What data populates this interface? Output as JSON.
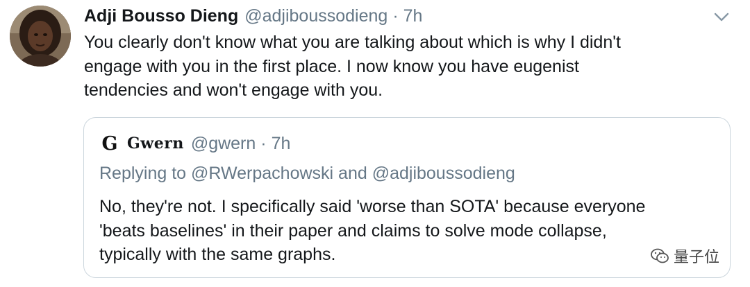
{
  "tweet": {
    "author_name": "Adji Bousso Dieng",
    "author_handle": "@adjiboussodieng",
    "separator": "·",
    "time": "7h",
    "text_lines": [
      "You clearly don't know what you are talking about which is why I didn't",
      "engage with you in the first place. I now know you have eugenist",
      "tendencies and won't engage with you."
    ],
    "menu_icon": "chevron-down-icon"
  },
  "quoted_tweet": {
    "avatar_glyph": "G",
    "author_name": "Gwern",
    "author_handle": "@gwern",
    "separator": "·",
    "time": "7h",
    "replying_to": "Replying to @RWerpachowski and @adjiboussodieng",
    "text_lines": [
      "No, they're not. I specifically said 'worse than SOTA' because everyone",
      "'beats baselines' in their paper and claims to solve mode collapse,",
      "typically with the same graphs."
    ]
  },
  "watermark": {
    "icon": "wechat-icon",
    "text": "量子位"
  },
  "colors": {
    "text_primary": "#14171a",
    "text_secondary": "#657786",
    "border": "#ccd6dd"
  }
}
